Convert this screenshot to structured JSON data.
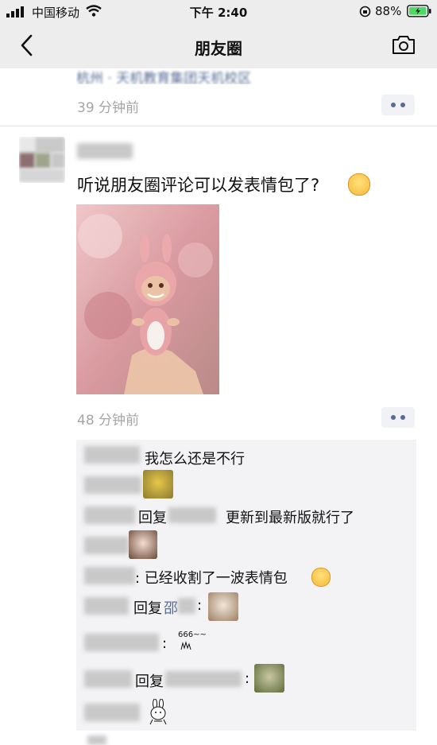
{
  "status_bar": {
    "carrier": "中国移动",
    "time": "下午 2:40",
    "battery": "88%"
  },
  "nav": {
    "title": "朋友圈"
  },
  "prev_post": {
    "location": "杭州 · 天机教育集团天机校区",
    "time": "39 分钟前"
  },
  "post": {
    "text": "听说朋友圈评论可以发表情包了?",
    "time": "48 分钟前"
  },
  "comments": [
    {
      "text": "我怎么还是不行"
    },
    {
      "reply_label": "回复",
      "text": "更新到最新版就行了"
    },
    {
      "text": ": 已经收割了一波表情包"
    },
    {
      "reply_label": "回复",
      "target": "邵",
      "colon": ":"
    },
    {
      "colon": ":",
      "sticker_text": "666~~"
    },
    {
      "reply_label": "回复",
      "colon": ":"
    }
  ],
  "colors": {
    "bar_bg": "#ededed",
    "link": "#576b95",
    "comment_bg": "#f3f3f5",
    "time_gray": "#a6a6a6",
    "battery_green": "#4cd964"
  }
}
